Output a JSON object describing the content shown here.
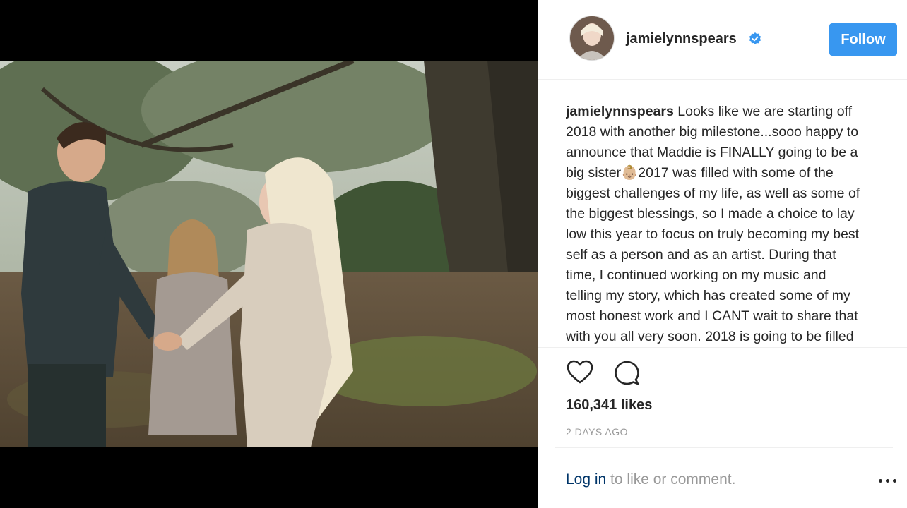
{
  "post": {
    "username": "jamielynnspears",
    "verified_icon": "verified-badge-icon",
    "follow_label": "Follow",
    "caption_user": "jamielynnspears",
    "caption_lines": [
      " Looks like we are starting off",
      "2018 with another big milestone...sooo happy to",
      "announce that Maddie is FINALLY going to be a",
      "big sister👶🏼2017 was filled with some of the",
      "biggest challenges of my life, as well as some of",
      "the biggest blessings, so I made a choice to lay",
      "low this year to focus on truly becoming my best",
      "self as a person and as an artist. During that",
      "time, I continued working on my music and",
      "telling my story, which has created some of my",
      "most honest work and I CANT wait to share that",
      "with you all very soon. 2018 is going to be filled"
    ],
    "likes": "160,341 likes",
    "timestamp": "2 DAYS AGO",
    "login_link": "Log in",
    "login_rest": " to like or comment."
  },
  "colors": {
    "follow_button": "#3897f0",
    "link": "#003569",
    "muted": "#999999",
    "text": "#262626"
  },
  "icons": {
    "like": "heart-icon",
    "comment": "comment-bubble-icon",
    "more": "more-options-icon"
  }
}
